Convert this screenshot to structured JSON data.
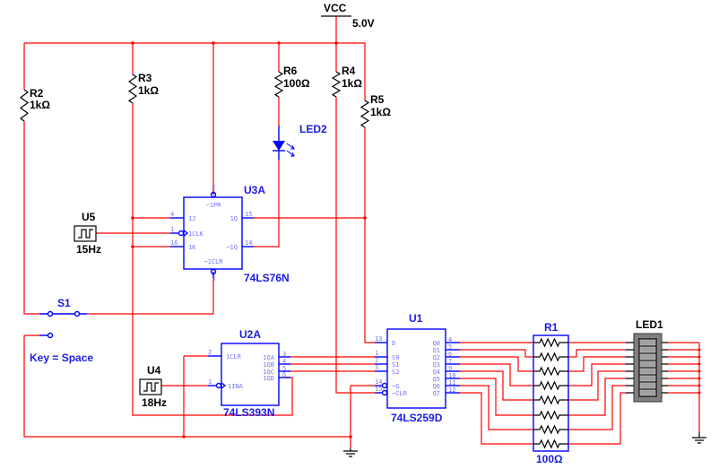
{
  "power": {
    "label": "VCC",
    "voltage": "5.0V"
  },
  "resistors": [
    {
      "ref": "R2",
      "value": "1kΩ"
    },
    {
      "ref": "R3",
      "value": "1kΩ"
    },
    {
      "ref": "R6",
      "value": "100Ω"
    },
    {
      "ref": "R4",
      "value": "1kΩ"
    },
    {
      "ref": "R5",
      "value": "1kΩ"
    }
  ],
  "led2": {
    "ref": "LED2"
  },
  "u3a": {
    "ref": "U3A",
    "part": "74LS76N",
    "pins_left": [
      {
        "num": "4",
        "name": "1J"
      },
      {
        "num": "1",
        "name": "1CLK"
      },
      {
        "num": "16",
        "name": "1K"
      }
    ],
    "pins_right": [
      {
        "num": "15",
        "name": "1Q"
      },
      {
        "num": "14",
        "name": "~1Q"
      }
    ],
    "pin_top": {
      "num": "2",
      "name": "~1PR"
    },
    "pin_bottom": {
      "num": "3",
      "name": "~1CLR"
    }
  },
  "u5": {
    "ref": "U5",
    "freq": "15Hz"
  },
  "s1": {
    "ref": "S1",
    "key": "Key = Space"
  },
  "u2a": {
    "ref": "U2A",
    "part": "74LS393N",
    "pins_left": [
      {
        "num": "2",
        "name": "1CLR"
      },
      {
        "num": "1",
        "name": "1INA"
      }
    ],
    "pins_right": [
      {
        "num": "3",
        "name": "1QA"
      },
      {
        "num": "4",
        "name": "1QB"
      },
      {
        "num": "5",
        "name": "1QC"
      },
      {
        "num": "6",
        "name": "1QD"
      }
    ]
  },
  "u4": {
    "ref": "U4",
    "freq": "18Hz"
  },
  "u1": {
    "ref": "U1",
    "part": "74LS259D",
    "pins_left": [
      {
        "num": "13",
        "name": "D"
      },
      {
        "num": "1",
        "name": "S0"
      },
      {
        "num": "2",
        "name": "S1"
      },
      {
        "num": "3",
        "name": "S2"
      },
      {
        "num": "14",
        "name": "~G"
      },
      {
        "num": "15",
        "name": "~CLR"
      }
    ],
    "pins_right": [
      {
        "num": "4",
        "name": "Q0"
      },
      {
        "num": "5",
        "name": "Q1"
      },
      {
        "num": "6",
        "name": "Q2"
      },
      {
        "num": "7",
        "name": "Q3"
      },
      {
        "num": "9",
        "name": "Q4"
      },
      {
        "num": "10",
        "name": "Q5"
      },
      {
        "num": "11",
        "name": "Q6"
      },
      {
        "num": "12",
        "name": "Q7"
      }
    ]
  },
  "r1": {
    "ref": "R1",
    "value": "100Ω"
  },
  "led1": {
    "ref": "LED1",
    "segments": 8
  },
  "colors": {
    "wire": "#ff0000",
    "component": "#0000ff",
    "pin_label": "#7373ff",
    "bargraph": "#808080"
  }
}
